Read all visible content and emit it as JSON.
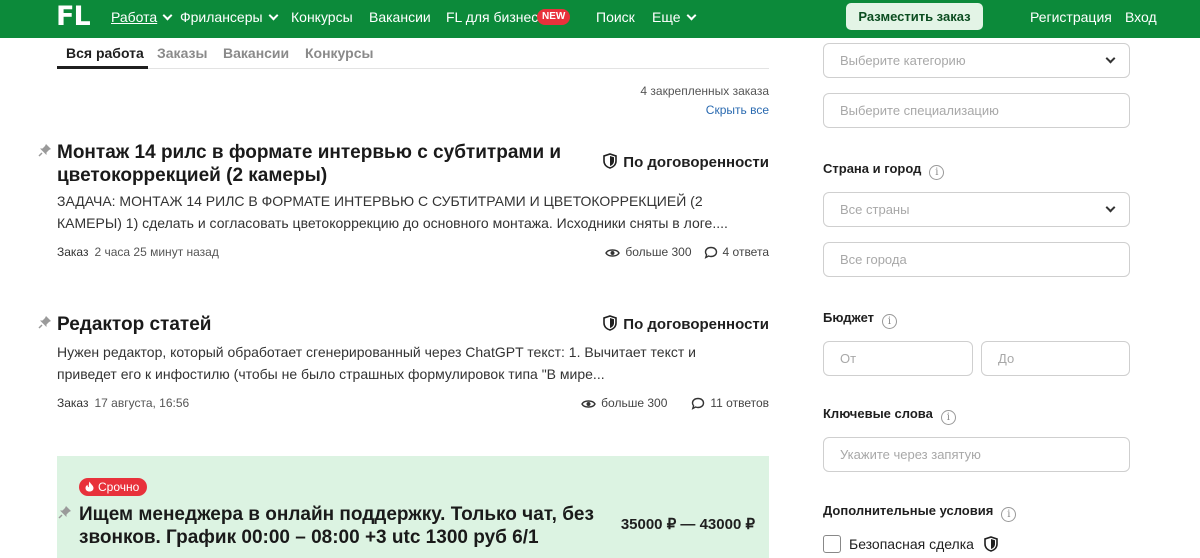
{
  "header": {
    "logo": "FL",
    "nav": [
      {
        "label": "Работа"
      },
      {
        "label": "Фрилансеры"
      },
      {
        "label": "Конкурсы"
      },
      {
        "label": "Вакансии"
      },
      {
        "label": "FL для бизнеса"
      },
      {
        "label": "Поиск"
      },
      {
        "label": "Еще"
      }
    ],
    "new_badge": "NEW",
    "post_order": "Разместить заказ",
    "register": "Регистрация",
    "login": "Вход"
  },
  "tabs": [
    {
      "label": "Вся работа",
      "active": true
    },
    {
      "label": "Заказы"
    },
    {
      "label": "Вакансии"
    },
    {
      "label": "Конкурсы"
    }
  ],
  "pinned": {
    "count_text": "4 закрепленных заказа",
    "hide_all": "Скрыть все"
  },
  "jobs": [
    {
      "title": "Монтаж 14 рилс в формате интервью с субтитрами и цветокоррекцией (2 камеры)",
      "budget": "По договоренности",
      "description": "ЗАДАЧА: МОНТАЖ 14 РИЛС В ФОРМАТЕ ИНТЕРВЬЮ С СУБТИТРАМИ И ЦВЕТОКОРРЕКЦИЕЙ (2 КАМЕРЫ) 1) сделать и согласовать  цветокоррекцию до основного монтажа. Исходники сняты в логе....",
      "type": "Заказ",
      "time": "2 часа 25 минут назад",
      "views": "больше 300",
      "answers": "4 ответа"
    },
    {
      "title": "Редактор статей",
      "budget": "По договоренности",
      "description": "Нужен редактор, который обработает сгенерированный через ChatGPT текст: 1. Вычитает текст и приведет его к инфостилю (чтобы не было страшных формулировок типа \"В мире...",
      "type": "Заказ",
      "time": "17 августа, 16:56",
      "views": "больше 300",
      "answers": "11 ответов"
    }
  ],
  "urgent_job": {
    "badge": "Срочно",
    "title": "Ищем менеджера в онлайн поддержку. Только чат, без звонков. График 00:00 – 08:00 +3 utc 1300 руб 6/1",
    "budget": "35000 ₽ — 43000 ₽"
  },
  "filters": {
    "category_placeholder": "Выберите категорию",
    "specialization_placeholder": "Выберите специализацию",
    "country_city_label": "Страна и город",
    "country_placeholder": "Все страны",
    "city_placeholder": "Все города",
    "budget_label": "Бюджет",
    "budget_from": "От",
    "budget_to": "До",
    "keywords_label": "Ключевые слова",
    "keywords_placeholder": "Укажите через запятую",
    "extra_label": "Дополнительные условия",
    "safe_deal": "Безопасная сделка"
  },
  "colors": {
    "brand_green": "#0c8a3a",
    "urgent_red": "#e8313b",
    "urgent_bg": "#dcf3e2",
    "link_blue": "#2a6ab0"
  }
}
